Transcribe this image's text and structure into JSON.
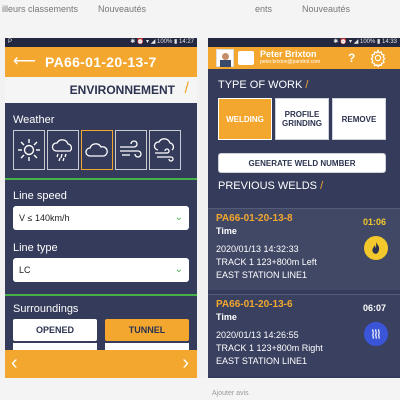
{
  "background": {
    "top_left_text": "illeurs classements",
    "top_mid_text": "Nouveautés",
    "top_right_1": "ents",
    "top_right_2": "Nouveautés",
    "bottom_text": "Ajouter avis"
  },
  "left_phone": {
    "status": {
      "left": "P",
      "right": "✱ ⏰ ▾ ◢ 100% ▮ 14:27"
    },
    "header": {
      "back_icon": "back-arrow-icon",
      "title": "PA66-01-20-13-7"
    },
    "section_banner": "ENVIRONNEMENT",
    "weather": {
      "label": "Weather",
      "options": [
        "sun-icon",
        "rain-cloud-icon",
        "cloud-icon",
        "wind-icon",
        "storm-icon"
      ],
      "selected_index": 2
    },
    "line_speed": {
      "label": "Line speed",
      "value": "V  ≤ 140km/h"
    },
    "line_type": {
      "label": "Line type",
      "value": "LC"
    },
    "surroundings": {
      "label": "Surroundings",
      "opened": "OPENED",
      "tunnel": "TUNNEL",
      "selected": "TUNNEL"
    },
    "footer": {
      "prev_icon": "chevron-left-icon",
      "next_icon": "chevron-right-icon"
    }
  },
  "right_phone": {
    "status": {
      "left": "",
      "right": "✱ ⏰ ▾ ◢ 100% ▮ 14:33"
    },
    "header": {
      "name": "Peter Brixton",
      "email": "peter.brixton@pandrol.com"
    },
    "type_of_work": {
      "title": "TYPE OF WORK",
      "buttons": [
        {
          "label": "WELDING",
          "selected": true
        },
        {
          "label": "PROFILE GRINDING",
          "selected": false
        },
        {
          "label": "REMOVE",
          "selected": false
        }
      ]
    },
    "generate_btn": "GENERATE WELD NUMBER",
    "previous_welds": {
      "title": "PREVIOUS WELDS",
      "items": [
        {
          "code": "PA66-01-20-13-8",
          "time_label": "Time",
          "duration": "01:06",
          "datetime": "2020/01/13 14:32:33",
          "track": "TRACK 1 123+800m Left",
          "station": "EAST STATION LINE1",
          "badge_icon": "flame-icon",
          "accent": "#f3c82c"
        },
        {
          "code": "PA66-01-20-13-6",
          "time_label": "Time",
          "duration": "06:07",
          "datetime": "2020/01/13 14:26:55",
          "track": "TRACK 1 123+800m Right",
          "station": "EAST STATION LINE1",
          "badge_icon": "heat-waves-icon",
          "accent": "#3b55d9"
        }
      ]
    }
  },
  "colors": {
    "orange": "#f3a72f",
    "navy": "#353b5a",
    "green": "#46b34a"
  }
}
